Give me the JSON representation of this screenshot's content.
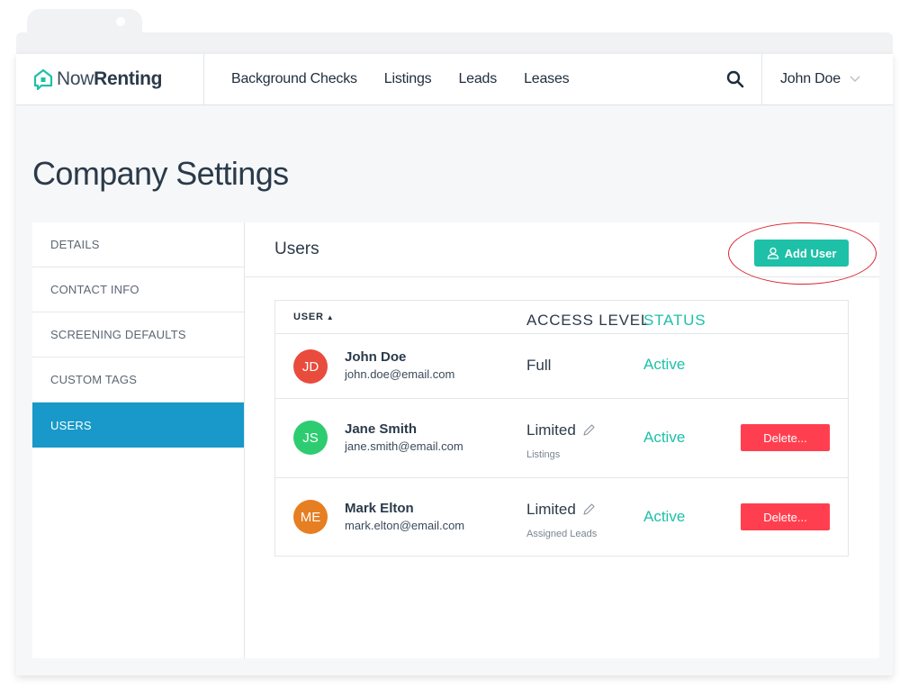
{
  "brand": {
    "light": "Now",
    "bold": "Renting"
  },
  "nav": {
    "items": [
      "Background Checks",
      "Listings",
      "Leads",
      "Leases"
    ]
  },
  "user_menu": {
    "name": "John Doe"
  },
  "page": {
    "title": "Company Settings"
  },
  "sidebar": {
    "items": [
      {
        "label": "DETAILS",
        "active": false
      },
      {
        "label": "CONTACT INFO",
        "active": false
      },
      {
        "label": "SCREENING DEFAULTS",
        "active": false
      },
      {
        "label": "CUSTOM TAGS",
        "active": false
      },
      {
        "label": "USERS",
        "active": true
      }
    ]
  },
  "users_panel": {
    "title": "Users",
    "add_button": "Add User",
    "columns": {
      "user": "USER",
      "access": "ACCESS LEVEL",
      "status": "STATUS"
    },
    "rows": [
      {
        "initials": "JD",
        "avatar_color": "#e94b3c",
        "name": "John Doe",
        "email": "john.doe@email.com",
        "access": "Full",
        "access_sub": "",
        "status": "Active",
        "delete_label": ""
      },
      {
        "initials": "JS",
        "avatar_color": "#2ecc71",
        "name": "Jane Smith",
        "email": "jane.smith@email.com",
        "access": "Limited",
        "access_sub": "Listings",
        "status": "Active",
        "delete_label": "Delete..."
      },
      {
        "initials": "ME",
        "avatar_color": "#e67e22",
        "name": "Mark Elton",
        "email": "mark.elton@email.com",
        "access": "Limited",
        "access_sub": "Assigned Leads",
        "status": "Active",
        "delete_label": "Delete..."
      }
    ]
  },
  "colors": {
    "accent": "#1ec0a8",
    "sidebar_active": "#1899c9",
    "danger": "#ff3f50",
    "highlight_ring": "#d9232e"
  }
}
